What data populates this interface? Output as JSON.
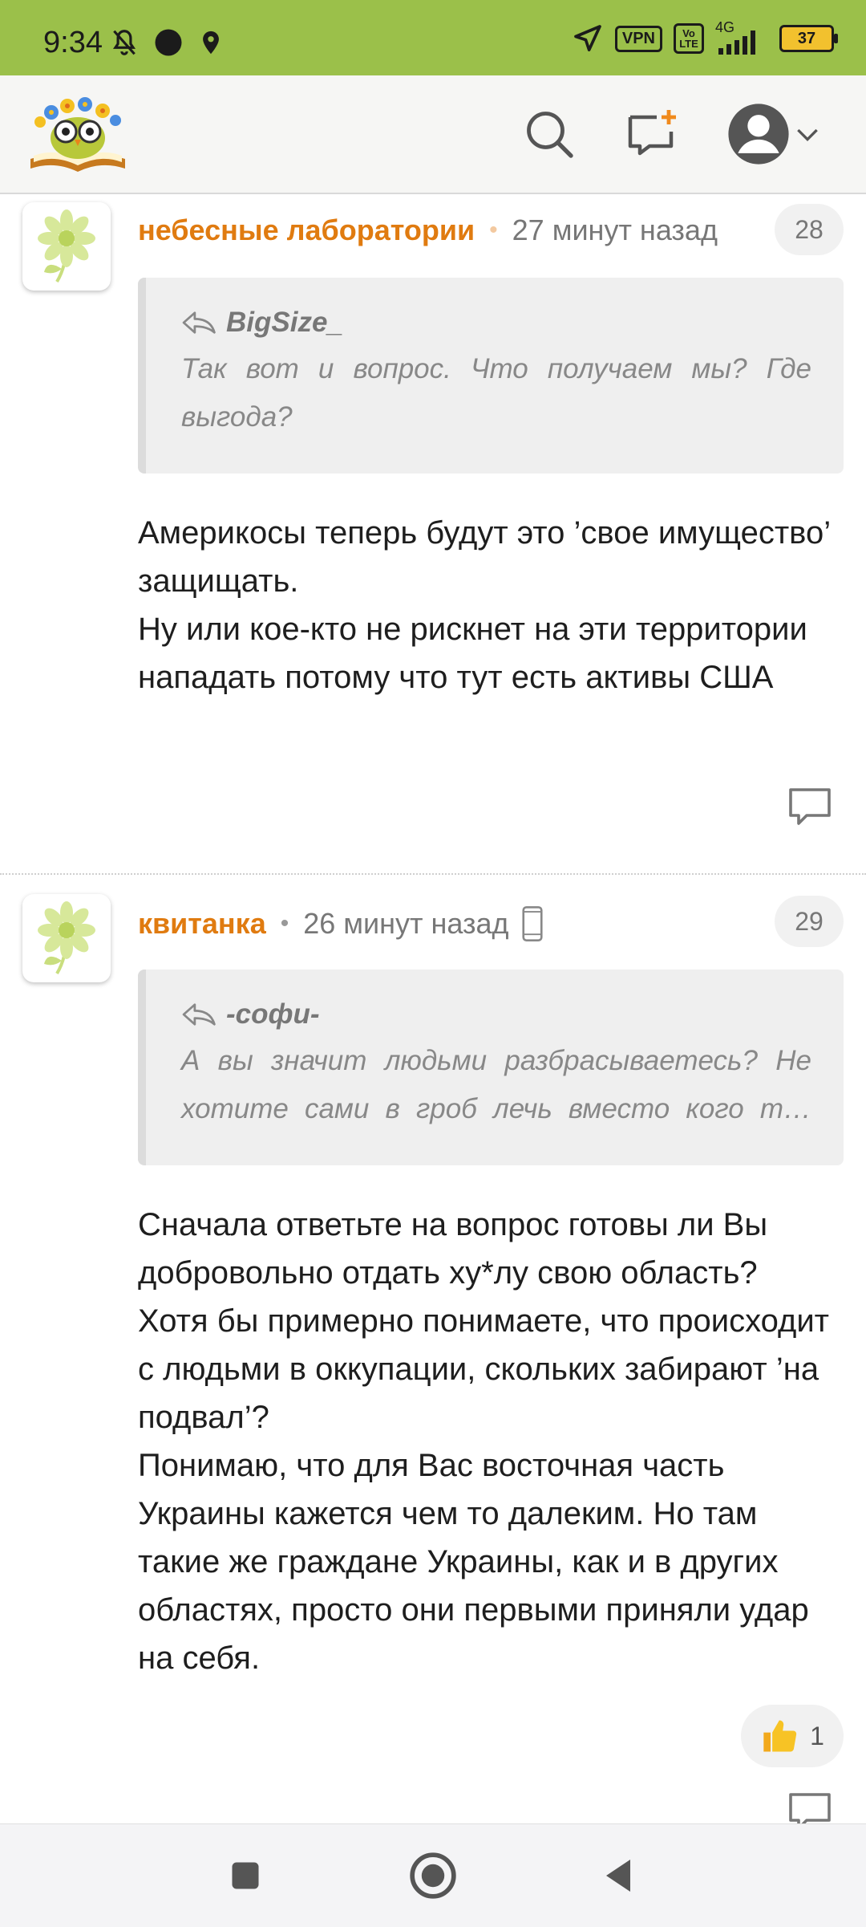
{
  "status_bar": {
    "time": "9:34",
    "vpn": "VPN",
    "volte": "Vo LTE",
    "network": "4G",
    "battery": "37",
    "icons": [
      "mute-bell-icon",
      "dot-icon",
      "location-pin-icon",
      "navigation-arrow-icon",
      "signal-icon"
    ]
  },
  "header": {
    "logo": "owl-on-book-logo",
    "icons": [
      "search-icon",
      "new-message-icon",
      "avatar-icon",
      "chevron-down-icon"
    ]
  },
  "colors": {
    "status_bar_bg": "#9bc04a",
    "author": "#e07b10",
    "quote_bg": "#efefef"
  },
  "comments": [
    {
      "author": "небесные лаборатории",
      "time": "27 минут назад",
      "number": "28",
      "quote_author": "BigSize_",
      "quote_text": "Так вот и вопрос. Что получаем мы? Где выгода?",
      "body": "Америкосы теперь будут это ’свое имущество’ защищать.\nНу или кое-кто не рискнет на эти территории нападать потому что тут есть активы США"
    },
    {
      "author": "квитанка",
      "time": "26 минут назад",
      "number": "29",
      "quote_author": "-софи-",
      "quote_text": "А вы значит людьми разбрасываетесь? Не хотите сами в гроб лечь вместо кого т…",
      "body": "Сначала ответьте на вопрос готовы ли Вы добровольно отдать ху*лу свою область?\nХотя бы примерно понимаете, что происходит с людьми в оккупации, скольких забирают ’на подвал’?\nПонимаю, что для Вас восточная часть Украины кажется чем то далеким. Но там такие же граждане Украины, как и в других областях, просто они первыми приняли удар на себя.",
      "likes": "1"
    }
  ]
}
